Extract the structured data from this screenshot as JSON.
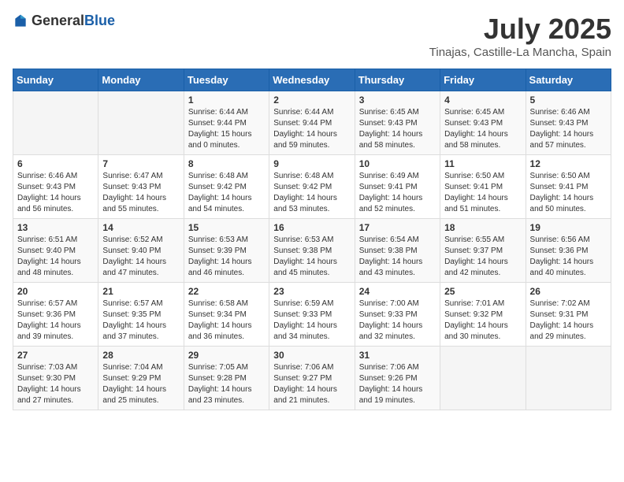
{
  "header": {
    "logo_general": "General",
    "logo_blue": "Blue",
    "month_year": "July 2025",
    "location": "Tinajas, Castille-La Mancha, Spain"
  },
  "weekdays": [
    "Sunday",
    "Monday",
    "Tuesday",
    "Wednesday",
    "Thursday",
    "Friday",
    "Saturday"
  ],
  "weeks": [
    [
      {
        "day": "",
        "info": ""
      },
      {
        "day": "",
        "info": ""
      },
      {
        "day": "1",
        "info": "Sunrise: 6:44 AM\nSunset: 9:44 PM\nDaylight: 15 hours\nand 0 minutes."
      },
      {
        "day": "2",
        "info": "Sunrise: 6:44 AM\nSunset: 9:44 PM\nDaylight: 14 hours\nand 59 minutes."
      },
      {
        "day": "3",
        "info": "Sunrise: 6:45 AM\nSunset: 9:43 PM\nDaylight: 14 hours\nand 58 minutes."
      },
      {
        "day": "4",
        "info": "Sunrise: 6:45 AM\nSunset: 9:43 PM\nDaylight: 14 hours\nand 58 minutes."
      },
      {
        "day": "5",
        "info": "Sunrise: 6:46 AM\nSunset: 9:43 PM\nDaylight: 14 hours\nand 57 minutes."
      }
    ],
    [
      {
        "day": "6",
        "info": "Sunrise: 6:46 AM\nSunset: 9:43 PM\nDaylight: 14 hours\nand 56 minutes."
      },
      {
        "day": "7",
        "info": "Sunrise: 6:47 AM\nSunset: 9:43 PM\nDaylight: 14 hours\nand 55 minutes."
      },
      {
        "day": "8",
        "info": "Sunrise: 6:48 AM\nSunset: 9:42 PM\nDaylight: 14 hours\nand 54 minutes."
      },
      {
        "day": "9",
        "info": "Sunrise: 6:48 AM\nSunset: 9:42 PM\nDaylight: 14 hours\nand 53 minutes."
      },
      {
        "day": "10",
        "info": "Sunrise: 6:49 AM\nSunset: 9:41 PM\nDaylight: 14 hours\nand 52 minutes."
      },
      {
        "day": "11",
        "info": "Sunrise: 6:50 AM\nSunset: 9:41 PM\nDaylight: 14 hours\nand 51 minutes."
      },
      {
        "day": "12",
        "info": "Sunrise: 6:50 AM\nSunset: 9:41 PM\nDaylight: 14 hours\nand 50 minutes."
      }
    ],
    [
      {
        "day": "13",
        "info": "Sunrise: 6:51 AM\nSunset: 9:40 PM\nDaylight: 14 hours\nand 48 minutes."
      },
      {
        "day": "14",
        "info": "Sunrise: 6:52 AM\nSunset: 9:40 PM\nDaylight: 14 hours\nand 47 minutes."
      },
      {
        "day": "15",
        "info": "Sunrise: 6:53 AM\nSunset: 9:39 PM\nDaylight: 14 hours\nand 46 minutes."
      },
      {
        "day": "16",
        "info": "Sunrise: 6:53 AM\nSunset: 9:38 PM\nDaylight: 14 hours\nand 45 minutes."
      },
      {
        "day": "17",
        "info": "Sunrise: 6:54 AM\nSunset: 9:38 PM\nDaylight: 14 hours\nand 43 minutes."
      },
      {
        "day": "18",
        "info": "Sunrise: 6:55 AM\nSunset: 9:37 PM\nDaylight: 14 hours\nand 42 minutes."
      },
      {
        "day": "19",
        "info": "Sunrise: 6:56 AM\nSunset: 9:36 PM\nDaylight: 14 hours\nand 40 minutes."
      }
    ],
    [
      {
        "day": "20",
        "info": "Sunrise: 6:57 AM\nSunset: 9:36 PM\nDaylight: 14 hours\nand 39 minutes."
      },
      {
        "day": "21",
        "info": "Sunrise: 6:57 AM\nSunset: 9:35 PM\nDaylight: 14 hours\nand 37 minutes."
      },
      {
        "day": "22",
        "info": "Sunrise: 6:58 AM\nSunset: 9:34 PM\nDaylight: 14 hours\nand 36 minutes."
      },
      {
        "day": "23",
        "info": "Sunrise: 6:59 AM\nSunset: 9:33 PM\nDaylight: 14 hours\nand 34 minutes."
      },
      {
        "day": "24",
        "info": "Sunrise: 7:00 AM\nSunset: 9:33 PM\nDaylight: 14 hours\nand 32 minutes."
      },
      {
        "day": "25",
        "info": "Sunrise: 7:01 AM\nSunset: 9:32 PM\nDaylight: 14 hours\nand 30 minutes."
      },
      {
        "day": "26",
        "info": "Sunrise: 7:02 AM\nSunset: 9:31 PM\nDaylight: 14 hours\nand 29 minutes."
      }
    ],
    [
      {
        "day": "27",
        "info": "Sunrise: 7:03 AM\nSunset: 9:30 PM\nDaylight: 14 hours\nand 27 minutes."
      },
      {
        "day": "28",
        "info": "Sunrise: 7:04 AM\nSunset: 9:29 PM\nDaylight: 14 hours\nand 25 minutes."
      },
      {
        "day": "29",
        "info": "Sunrise: 7:05 AM\nSunset: 9:28 PM\nDaylight: 14 hours\nand 23 minutes."
      },
      {
        "day": "30",
        "info": "Sunrise: 7:06 AM\nSunset: 9:27 PM\nDaylight: 14 hours\nand 21 minutes."
      },
      {
        "day": "31",
        "info": "Sunrise: 7:06 AM\nSunset: 9:26 PM\nDaylight: 14 hours\nand 19 minutes."
      },
      {
        "day": "",
        "info": ""
      },
      {
        "day": "",
        "info": ""
      }
    ]
  ]
}
